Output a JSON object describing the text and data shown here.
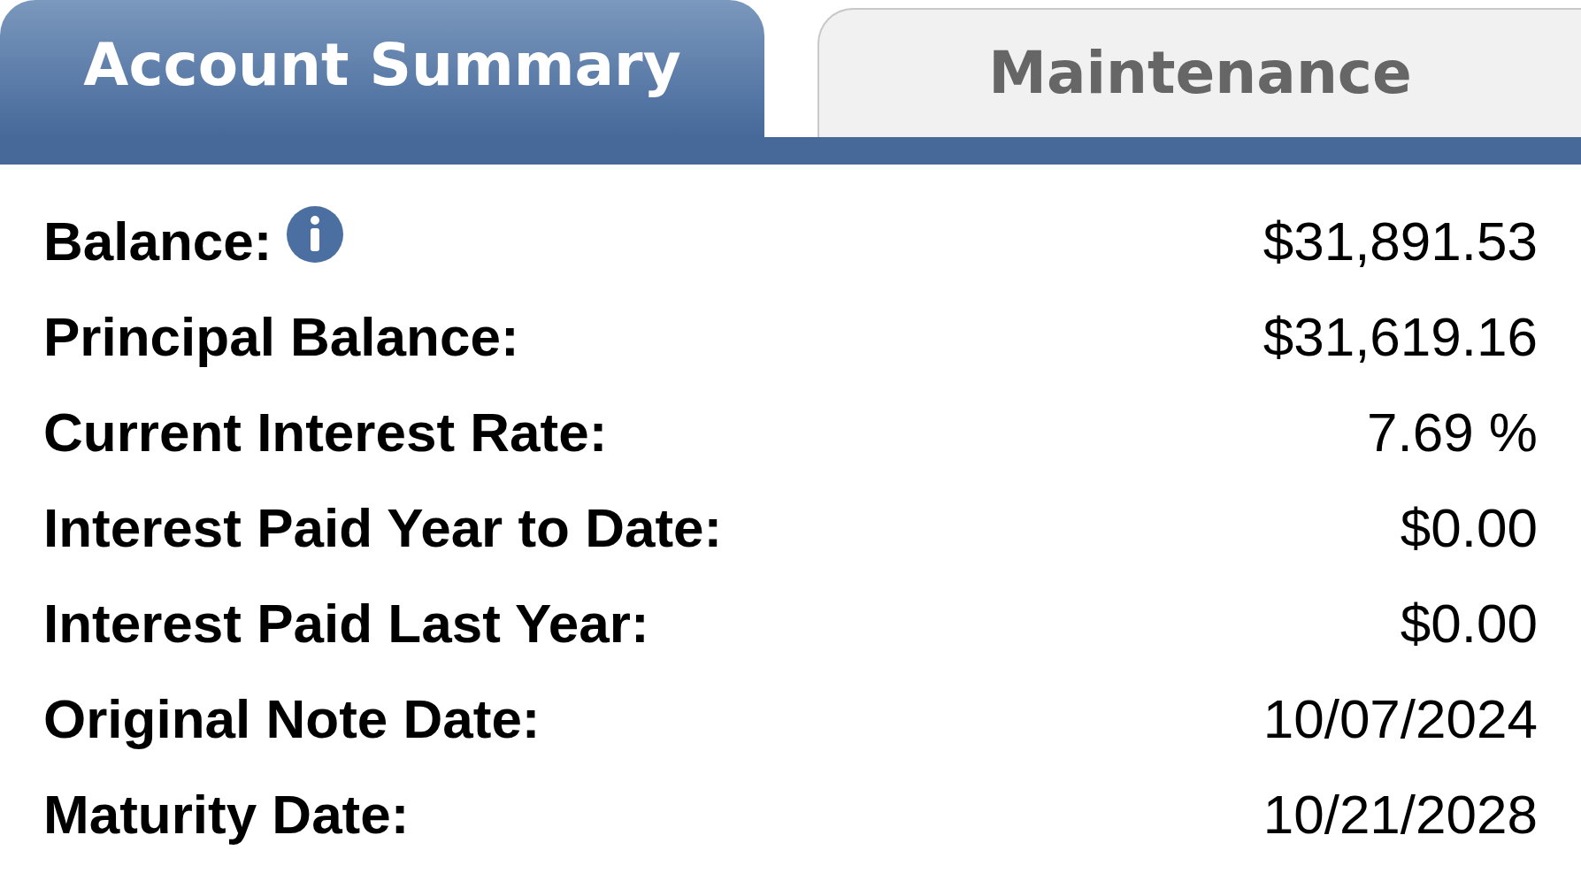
{
  "tabs": [
    {
      "label": "Account Summary",
      "selected": true
    },
    {
      "label": "Maintenance",
      "selected": false
    }
  ],
  "rows": [
    {
      "label": "Balance:",
      "value": "$31,891.53",
      "info": true
    },
    {
      "label": "Principal Balance:",
      "value": "$31,619.16",
      "info": false
    },
    {
      "label": "Current Interest Rate:",
      "value": "7.69 %",
      "info": false
    },
    {
      "label": "Interest Paid Year to Date:",
      "value": "$0.00",
      "info": false
    },
    {
      "label": "Interest Paid Last Year:",
      "value": "$0.00",
      "info": false
    },
    {
      "label": "Original Note Date:",
      "value": "10/07/2024",
      "info": false
    },
    {
      "label": "Maturity Date:",
      "value": "10/21/2028",
      "info": false
    }
  ]
}
